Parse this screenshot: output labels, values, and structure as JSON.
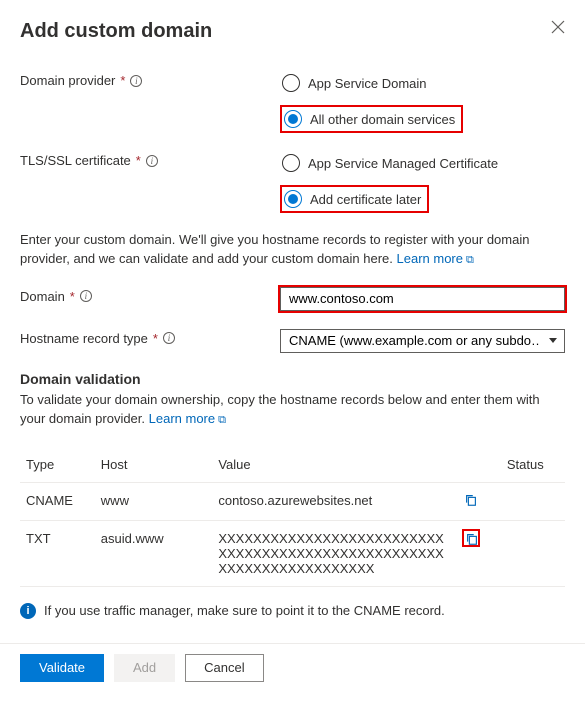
{
  "header": {
    "title": "Add custom domain"
  },
  "domain_provider": {
    "label": "Domain provider",
    "opt_app_service": "App Service Domain",
    "opt_other": "All other domain services"
  },
  "tls": {
    "label": "TLS/SSL certificate",
    "opt_managed": "App Service Managed Certificate",
    "opt_later": "Add certificate later"
  },
  "helper": {
    "text": "Enter your custom domain. We'll give you hostname records to register with your domain provider, and we can validate and add your custom domain here. ",
    "link": "Learn more"
  },
  "domain": {
    "label": "Domain",
    "value": "www.contoso.com"
  },
  "hostname_type": {
    "label": "Hostname record type",
    "value": "CNAME (www.example.com or any subdo…"
  },
  "validation": {
    "heading": "Domain validation",
    "text": "To validate your domain ownership, copy the hostname records below and enter them with your domain provider. ",
    "link": "Learn more"
  },
  "table": {
    "headers": {
      "type": "Type",
      "host": "Host",
      "value": "Value",
      "status": "Status"
    },
    "rows": [
      {
        "type": "CNAME",
        "host": "www",
        "value": "contoso.azurewebsites.net"
      },
      {
        "type": "TXT",
        "host": "asuid.www",
        "value": "XXXXXXXXXXXXXXXXXXXXXXXXXXXXXXXXXXXXXXXXXXXXXXXXXXXXXXXXXXXXXXXXXXXXXX"
      }
    ]
  },
  "note": "If you use traffic manager, make sure to point it to the CNAME record.",
  "footer": {
    "validate": "Validate",
    "add": "Add",
    "cancel": "Cancel"
  }
}
